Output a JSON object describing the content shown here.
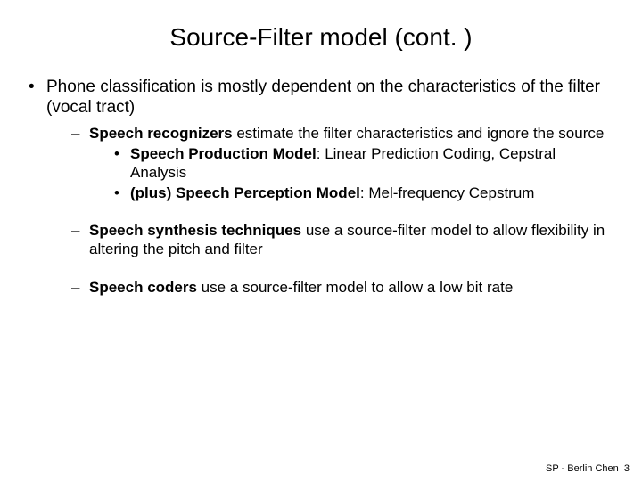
{
  "title": "Source-Filter model (cont. )",
  "main_bullet": "Phone classification is mostly dependent on the characteristics of the filter (vocal tract)",
  "sub": [
    {
      "lead_bold": "Speech recognizers",
      "tail": " estimate the filter characteristics and ignore the source",
      "items": [
        {
          "lead_bold": "Speech Production Model",
          "tail_plain": ": ",
          "tail_comic": "Linear Prediction Coding, Cepstral Analysis"
        },
        {
          "lead_bold": "(plus) Speech Perception Model",
          "tail_plain": ": ",
          "tail_comic": "Mel-frequency Cepstrum"
        }
      ]
    },
    {
      "lead_bold": "Speech synthesis techniques",
      "tail": " use a source-filter model to allow flexibility in altering the pitch and filter"
    },
    {
      "lead_bold": "Speech coders",
      "tail": " use a source-filter model to allow a low bit rate"
    }
  ],
  "footer": {
    "credit": "SP - Berlin Chen",
    "page": "3"
  }
}
